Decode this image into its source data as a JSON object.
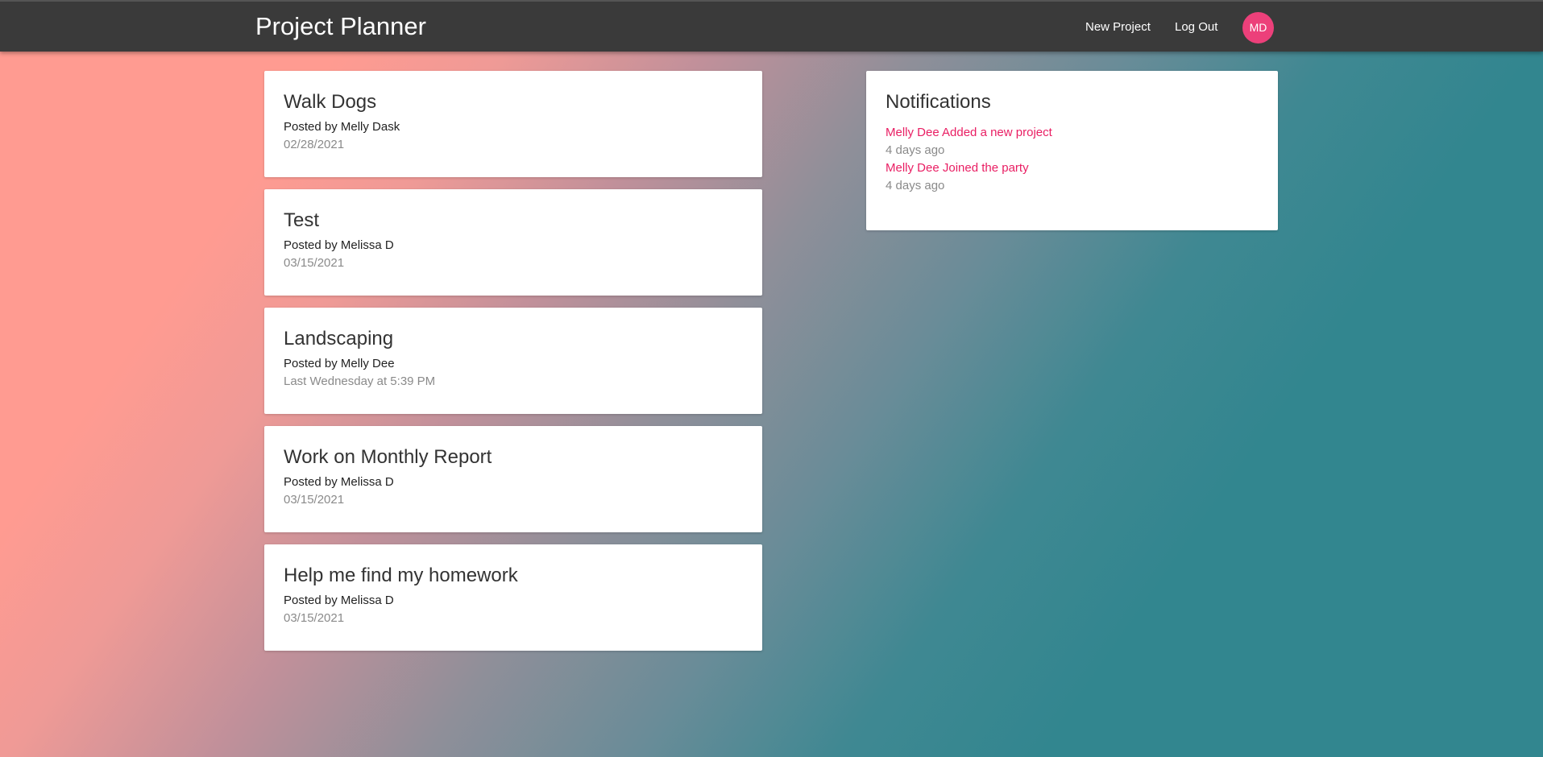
{
  "navbar": {
    "brand": "Project Planner",
    "links": {
      "new_project": "New Project",
      "log_out": "Log Out"
    },
    "avatar_initials": "MD",
    "avatar_color": "#ec407a",
    "background": "#3a3a3a"
  },
  "projects": [
    {
      "title": "Walk Dogs",
      "author": "Posted by Melly Dask",
      "date": "02/28/2021"
    },
    {
      "title": "Test",
      "author": "Posted by Melissa D",
      "date": "03/15/2021"
    },
    {
      "title": "Landscaping",
      "author": "Posted by Melly Dee",
      "date": "Last Wednesday at 5:39 PM"
    },
    {
      "title": "Work on Monthly Report",
      "author": "Posted by Melissa D",
      "date": "03/15/2021"
    },
    {
      "title": "Help me find my homework",
      "author": "Posted by Melissa D",
      "date": "03/15/2021"
    }
  ],
  "notifications": {
    "title": "Notifications",
    "items": [
      {
        "text": "Melly Dee Added a new project",
        "time": "4 days ago"
      },
      {
        "text": "Melly Dee Joined the party",
        "time": "4 days ago"
      }
    ],
    "accent_color": "#e91e63"
  }
}
